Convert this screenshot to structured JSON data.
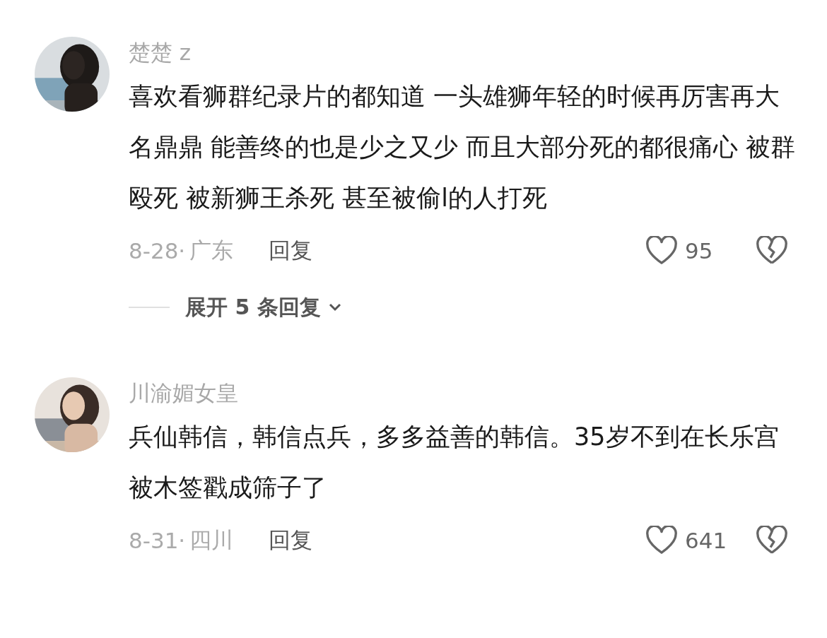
{
  "comments": [
    {
      "user": "楚楚 z",
      "text": "喜欢看狮群纪录片的都知道 一头雄狮年轻的时候再厉害再大名鼎鼎 能善终的也是少之又少 而且大部分死的都很痛心 被群殴死 被新狮王杀死 甚至被偷l的人打死",
      "date": "8-28·",
      "region": "广东",
      "reply": "回复",
      "likes": "95",
      "expand": "展开 5 条回复"
    },
    {
      "user": "川渝媚女皇",
      "text": "兵仙韩信，韩信点兵，多多益善的韩信。35岁不到在长乐宫被木签戳成筛子了",
      "date": "8-31·",
      "region": "四川",
      "reply": "回复",
      "likes": "641"
    }
  ]
}
